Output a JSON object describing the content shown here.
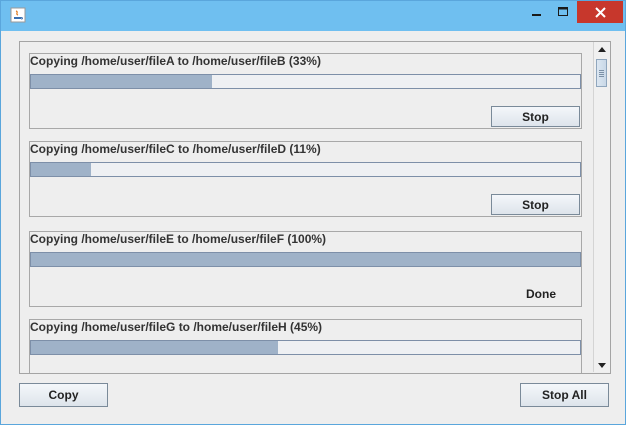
{
  "window": {
    "title": "",
    "icon": "java-icon",
    "controls": {
      "minimize": "minimize-icon",
      "maximize": "maximize-icon",
      "close": "close-icon"
    }
  },
  "tasks": [
    {
      "label": "Copying /home/user/fileA to /home/user/fileB (33%)",
      "progress": 0.33,
      "action": "Stop"
    },
    {
      "label": "Copying /home/user/fileC to /home/user/fileD (11%)",
      "progress": 0.11,
      "action": "Stop"
    },
    {
      "label": "Copying /home/user/fileE to /home/user/fileF (100%)",
      "progress": 1.0,
      "status": "Done"
    },
    {
      "label": "Copying /home/user/fileG to /home/user/fileH (45%)",
      "progress": 0.45
    }
  ],
  "buttons": {
    "copy": "Copy",
    "stop_all": "Stop All"
  }
}
